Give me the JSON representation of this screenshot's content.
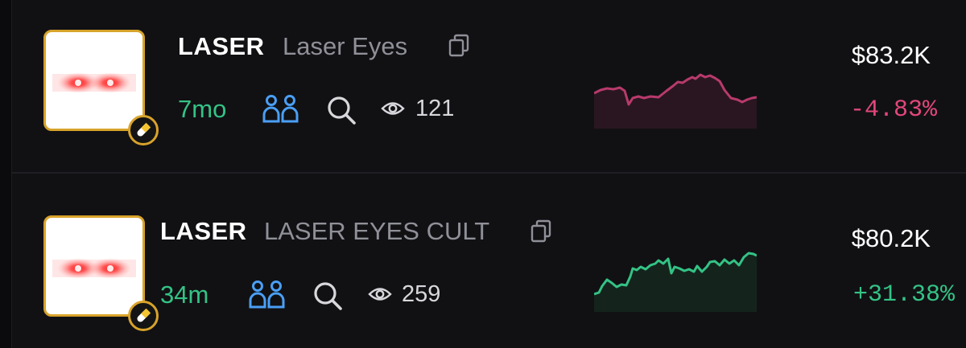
{
  "tokens": [
    {
      "ticker": "LASER",
      "name": "Laser Eyes",
      "age": "7mo",
      "views": "121",
      "market_cap": "$83.2K",
      "change": "-4.83%",
      "trend": "down",
      "spark_color": "#b83a6c",
      "spark_fill": "#2a1620"
    },
    {
      "ticker": "LASER",
      "name": "LASER EYES CULT",
      "age": "34m",
      "views": "259",
      "market_cap": "$80.2K",
      "change": "+31.38%",
      "trend": "up",
      "spark_color": "#34c385",
      "spark_fill": "#14241d"
    }
  ],
  "colors": {
    "background": "#111114",
    "accent_gold": "#d8a32a",
    "positive": "#34c385",
    "negative": "#e2477a",
    "holders_icon": "#4a9ff5"
  },
  "icons": [
    "copy-icon",
    "holders-icon",
    "search-icon",
    "eye-icon",
    "pill-icon"
  ]
}
